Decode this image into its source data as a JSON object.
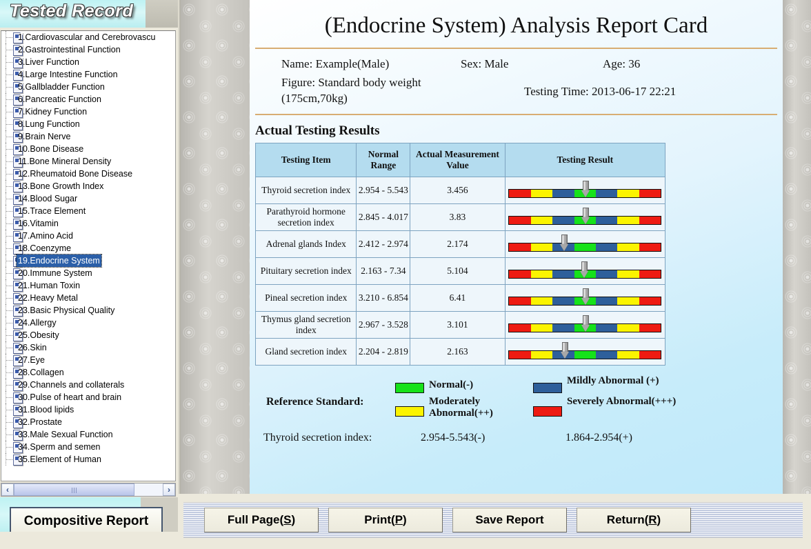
{
  "left_panel": {
    "title": "Tested Record",
    "composite_report_button": "Compositive Report",
    "scroll_left_icon": "‹",
    "scroll_right_icon": "›",
    "items": [
      {
        "label": "1.Cardiovascular and Cerebrovascu",
        "selected": false
      },
      {
        "label": "2.Gastrointestinal Function",
        "selected": false
      },
      {
        "label": "3.Liver Function",
        "selected": false
      },
      {
        "label": "4.Large Intestine Function",
        "selected": false
      },
      {
        "label": "5.Gallbladder Function",
        "selected": false
      },
      {
        "label": "6.Pancreatic Function",
        "selected": false
      },
      {
        "label": "7.Kidney Function",
        "selected": false
      },
      {
        "label": "8.Lung Function",
        "selected": false
      },
      {
        "label": "9.Brain Nerve",
        "selected": false
      },
      {
        "label": "10.Bone Disease",
        "selected": false
      },
      {
        "label": "11.Bone Mineral Density",
        "selected": false
      },
      {
        "label": "12.Rheumatoid Bone Disease",
        "selected": false
      },
      {
        "label": "13.Bone Growth Index",
        "selected": false
      },
      {
        "label": "14.Blood Sugar",
        "selected": false
      },
      {
        "label": "15.Trace Element",
        "selected": false
      },
      {
        "label": "16.Vitamin",
        "selected": false
      },
      {
        "label": "17.Amino Acid",
        "selected": false
      },
      {
        "label": "18.Coenzyme",
        "selected": false
      },
      {
        "label": "19.Endocrine System",
        "selected": true
      },
      {
        "label": "20.Immune System",
        "selected": false
      },
      {
        "label": "21.Human Toxin",
        "selected": false
      },
      {
        "label": "22.Heavy Metal",
        "selected": false
      },
      {
        "label": "23.Basic Physical Quality",
        "selected": false
      },
      {
        "label": "24.Allergy",
        "selected": false
      },
      {
        "label": "25.Obesity",
        "selected": false
      },
      {
        "label": "26.Skin",
        "selected": false
      },
      {
        "label": "27.Eye",
        "selected": false
      },
      {
        "label": "28.Collagen",
        "selected": false
      },
      {
        "label": "29.Channels and collaterals",
        "selected": false
      },
      {
        "label": "30.Pulse of heart and brain",
        "selected": false
      },
      {
        "label": "31.Blood lipids",
        "selected": false
      },
      {
        "label": "32.Prostate",
        "selected": false
      },
      {
        "label": "33.Male Sexual Function",
        "selected": false
      },
      {
        "label": "34.Sperm and semen",
        "selected": false
      },
      {
        "label": "35.Element of Human",
        "selected": false
      }
    ]
  },
  "report": {
    "title": "(Endocrine System) Analysis Report Card",
    "name": "Name: Example(Male)",
    "sex": "Sex: Male",
    "age": "Age: 36",
    "figure": "Figure: Standard body weight (175cm,70kg)",
    "testing_time": "Testing Time: 2013-06-17 22:21",
    "results_heading": "Actual Testing Results",
    "table": {
      "headers": [
        "Testing Item",
        "Normal Range",
        "Actual Measurement Value",
        "Testing Result"
      ],
      "rows": [
        {
          "item": "Thyroid secretion index",
          "range": "2.954 - 5.543",
          "value": "3.456",
          "arrow_segment": 3,
          "arrow_offset": 0.55
        },
        {
          "item": "Parathyroid hormone secretion index",
          "range": "2.845 - 4.017",
          "value": "3.83",
          "arrow_segment": 3,
          "arrow_offset": 0.55
        },
        {
          "item": "Adrenal glands Index",
          "range": "2.412 - 2.974",
          "value": "2.174",
          "arrow_segment": 2,
          "arrow_offset": 0.55
        },
        {
          "item": "Pituitary secretion index",
          "range": "2.163 - 7.34",
          "value": "5.104",
          "arrow_segment": 3,
          "arrow_offset": 0.48
        },
        {
          "item": "Pineal secretion index",
          "range": "3.210 - 6.854",
          "value": "6.41",
          "arrow_segment": 3,
          "arrow_offset": 0.55
        },
        {
          "item": "Thymus gland secretion index",
          "range": "2.967 - 3.528",
          "value": "3.101",
          "arrow_segment": 3,
          "arrow_offset": 0.55
        },
        {
          "item": "Gland secretion index",
          "range": "2.204 - 2.819",
          "value": "2.163",
          "arrow_segment": 2,
          "arrow_offset": 0.6
        }
      ]
    },
    "bar_segments": [
      {
        "color": "#ee1b12",
        "name": "red"
      },
      {
        "color": "#fbf400",
        "name": "yellow"
      },
      {
        "color": "#2e5f9b",
        "name": "blue"
      },
      {
        "color": "#16e21a",
        "name": "green"
      },
      {
        "color": "#2e5f9b",
        "name": "blue"
      },
      {
        "color": "#fbf400",
        "name": "yellow"
      },
      {
        "color": "#ee1b12",
        "name": "red"
      }
    ],
    "legend": {
      "title": "Reference Standard:",
      "entries": [
        {
          "label": "Normal(-)",
          "color": "#16e21a"
        },
        {
          "label": "Mildly Abnormal (+)",
          "color": "#2e5f9b"
        },
        {
          "label": "Moderately Abnormal(++)",
          "color": "#fbf400"
        },
        {
          "label": "Severely Abnormal(+++)",
          "color": "#ee1b12"
        }
      ]
    },
    "footer": {
      "label": "Thyroid secretion index:",
      "value1": "2.954-5.543(-)",
      "value2": "1.864-2.954(+)"
    }
  },
  "bottom_bar": {
    "buttons": [
      {
        "text": "Full Page(S)",
        "pre": "Full Page(",
        "key": "S",
        "post": ")"
      },
      {
        "text": "Print(P)",
        "pre": "Print(",
        "key": "P",
        "post": ")"
      },
      {
        "text": "Save Report",
        "pre": "Save Report",
        "key": "",
        "post": ""
      },
      {
        "text": "Return(R)",
        "pre": "Return(",
        "key": "R",
        "post": ")"
      }
    ]
  }
}
